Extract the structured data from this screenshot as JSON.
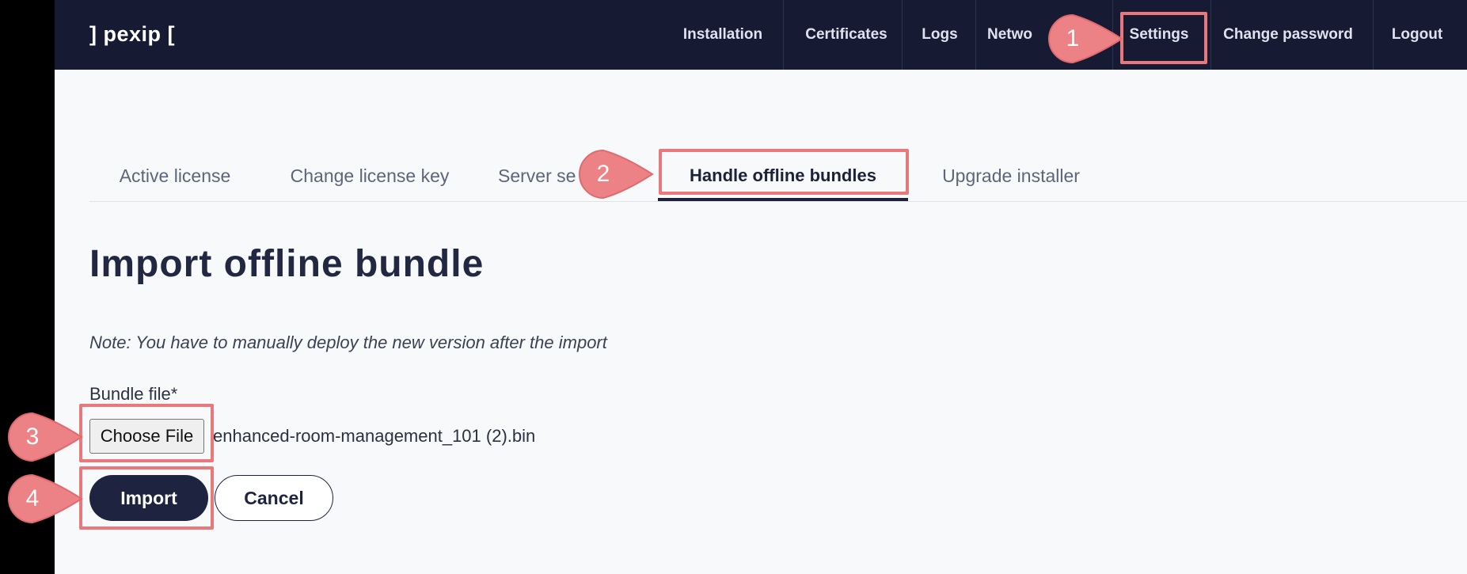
{
  "app": {
    "logo": "] pexip ["
  },
  "nav": {
    "items": [
      {
        "label": "Installation"
      },
      {
        "label": "Certificates"
      },
      {
        "label": "Logs"
      },
      {
        "label": "Netwo"
      },
      {
        "label": "Settings"
      },
      {
        "label": "Change password"
      },
      {
        "label": "Logout"
      }
    ]
  },
  "tabs": {
    "items": [
      {
        "label": "Active license"
      },
      {
        "label": "Change license key"
      },
      {
        "label": "Server se"
      },
      {
        "label": "Handle offline bundles",
        "active": true
      },
      {
        "label": "Upgrade installer"
      }
    ]
  },
  "main": {
    "title": "Import offline bundle",
    "note": "Note: You have to manually deploy the new version after the import",
    "field_label": "Bundle file*",
    "choose_label": "Choose File",
    "file_name": "enhanced-room-management_101 (2).bin",
    "import_label": "Import",
    "cancel_label": "Cancel"
  },
  "callouts": [
    {
      "number": "1"
    },
    {
      "number": "2"
    },
    {
      "number": "3"
    },
    {
      "number": "4"
    }
  ],
  "colors": {
    "nav_bg": "#161a33",
    "accent_dark": "#1e2340",
    "callout": "#e8787c"
  }
}
